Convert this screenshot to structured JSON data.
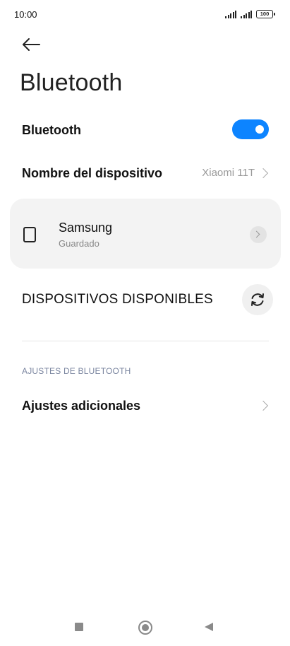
{
  "status_bar": {
    "time": "10:00",
    "battery": "100",
    "signal_icon": "cellular-signal-icon"
  },
  "header": {
    "back_icon": "arrow-left-icon",
    "title": "Bluetooth"
  },
  "bluetooth_row": {
    "label": "Bluetooth",
    "toggle_on": true,
    "accent_color": "#0d84ff"
  },
  "device_name_row": {
    "label": "Nombre del dispositivo",
    "value": "Xiaomi 11T"
  },
  "saved_device": {
    "icon": "device-icon",
    "name": "Samsung",
    "status": "Guardado"
  },
  "available_section": {
    "title": "DISPOSITIVOS DISPONIBLES",
    "refresh_icon": "refresh-icon"
  },
  "settings_section": {
    "header": "AJUSTES DE BLUETOOTH",
    "items": [
      {
        "label": "Ajustes adicionales"
      }
    ]
  },
  "nav_bar": {
    "recents_icon": "square-icon",
    "home_icon": "circle-icon",
    "back_icon": "triangle-back-icon"
  }
}
